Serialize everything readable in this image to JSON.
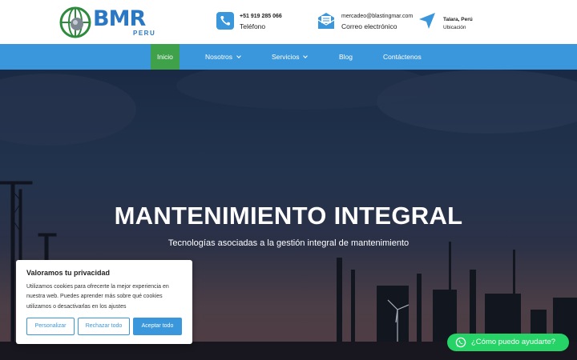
{
  "brand": {
    "logo_word": "BMR",
    "logo_sub": "PERU"
  },
  "contacts": {
    "phone": {
      "line1": "+51 919 285 066",
      "line2": "Teléfono",
      "icon": "phone-icon"
    },
    "email": {
      "line1": "mercadeo@blastingmar.com",
      "line2": "Correo electrónico",
      "icon": "mail-icon"
    },
    "location": {
      "line1": "Talara, Perú",
      "line2": "Ubicación",
      "icon": "location-arrow-icon"
    }
  },
  "nav": {
    "items": [
      {
        "label": "Inicio",
        "active": true
      },
      {
        "label": "Nosotros",
        "dropdown": true
      },
      {
        "label": "Servicios",
        "dropdown": true
      },
      {
        "label": "Blog"
      },
      {
        "label": "Contáctenos"
      }
    ]
  },
  "hero": {
    "title": "MANTENIMIENTO INTEGRAL",
    "subtitle": "Tecnologías asociadas a la gestión integral de mantenimiento"
  },
  "cookie": {
    "title": "Valoramos tu privacidad",
    "text": "Utilizamos cookies para ofrecerte la mejor experiencia en nuestra web. Puedes aprender más sobre qué cookies utilizamos o desactivarlas en los ajustes",
    "customize_label": "Personalizar",
    "reject_label": "Rechazar todo",
    "accept_label": "Aceptar todo"
  },
  "whatsapp": {
    "label": "¿Cómo puedo ayudarte?",
    "icon": "whatsapp-icon"
  },
  "colors": {
    "nav_blue": "#3a97dc",
    "active_green": "#3fa24a",
    "brand_blue": "#2a78c4",
    "whatsapp_green": "#25d366"
  }
}
